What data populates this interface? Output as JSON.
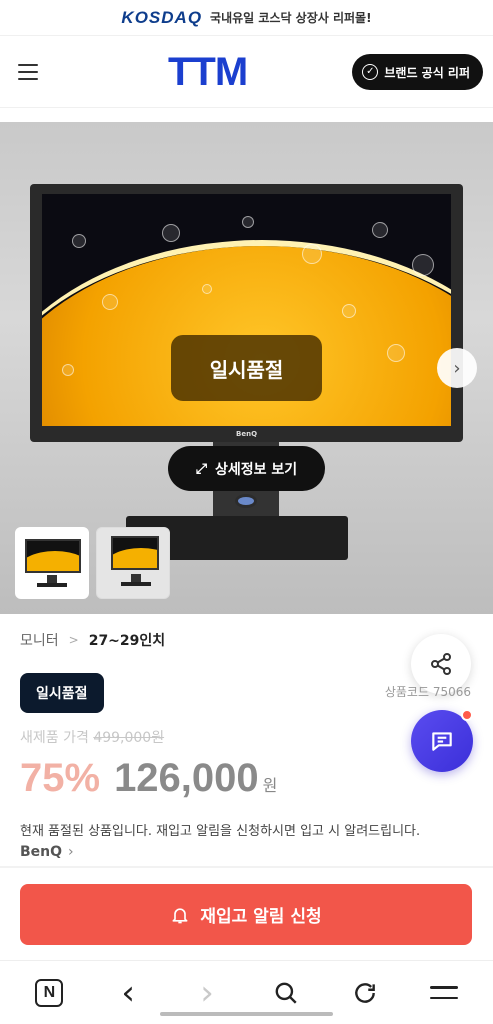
{
  "banner": {
    "logo": "KOSDAQ",
    "text": "국내유일 코스닥 상장사 리퍼몰!"
  },
  "header": {
    "logo": "TTM",
    "brand_button": "브랜드 공식 리퍼"
  },
  "hero": {
    "monitor_brand": "BenQ",
    "overlay_label": "일시품절",
    "detail_button": "상세정보 보기"
  },
  "breadcrumb": {
    "level1": "모니터",
    "separator": ">",
    "level2": "27~29인치"
  },
  "product": {
    "status_badge": "일시품절",
    "code": "상품코드 75066",
    "original_price_label": "새제품 가격",
    "original_price": "499,000원",
    "discount": "75%",
    "price": "126,000",
    "currency": "원",
    "notice": "현재 품절된 상품입니다. 재입고 알림을 신청하시면 입고 시 알려드립니다.",
    "brand": "BenQ"
  },
  "cta": {
    "label": "재입고 알림 신청"
  },
  "browser_nav": {
    "n_label": "N",
    "back": "‹",
    "forward": "›"
  },
  "colors": {
    "accent": "#f2564a",
    "brand_blue": "#1b3fcf",
    "chat": "#4a3de6",
    "badge": "#0c1a2d"
  }
}
